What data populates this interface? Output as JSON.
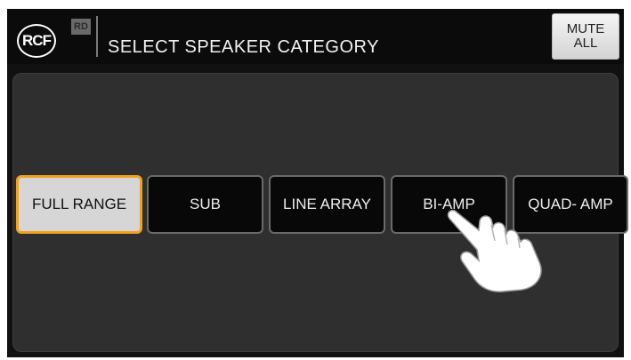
{
  "header": {
    "logo_text": "RCF",
    "badge_text": "RD",
    "title": "SELECT SPEAKER CATEGORY",
    "mute_label_line1": "MUTE",
    "mute_label_line2": "ALL"
  },
  "categories": [
    {
      "label": "FULL RANGE",
      "selected": true
    },
    {
      "label": "SUB",
      "selected": false
    },
    {
      "label": "LINE ARRAY",
      "selected": false
    },
    {
      "label": "BI-AMP",
      "selected": false
    },
    {
      "label": "QUAD- AMP",
      "selected": false
    }
  ],
  "colors": {
    "selected_border": "#f2a21c",
    "selected_fill": "#d6d6d6",
    "button_fill": "#080808",
    "panel": "#2f2f2f"
  },
  "overlay": {
    "icon": "pointing-hand-icon"
  }
}
